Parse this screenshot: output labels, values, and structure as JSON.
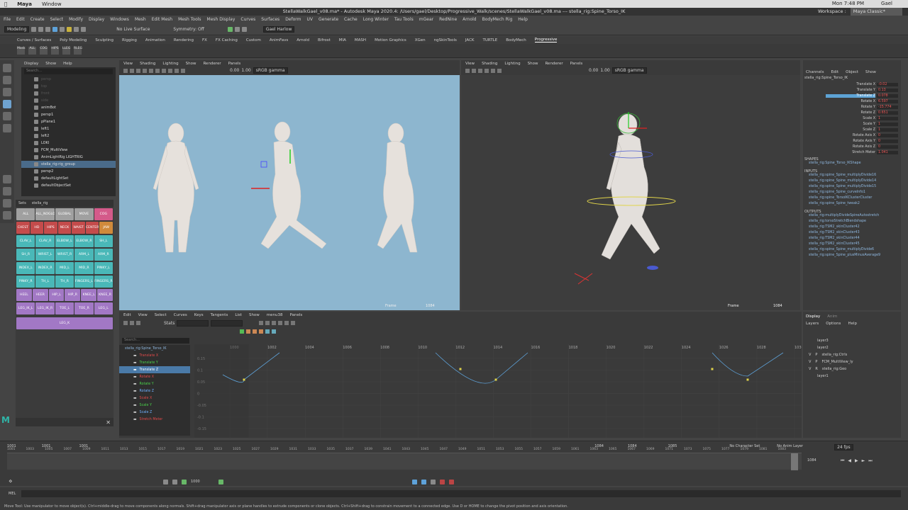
{
  "mac": {
    "app": "Maya",
    "menu": [
      "Window"
    ],
    "time": "Mon 7:48 PM",
    "user": "Gael"
  },
  "title": "StellaWalkGael_v08.ma* - Autodesk Maya 2020.4: /Users/gael/Desktop/Progressive_Walk/scenes/StellaWalkGael_v08.ma  ---  stella_rig:Spine_Torso_IK",
  "workspace": {
    "label": "Workspace :",
    "value": "Maya Classic*"
  },
  "menus": [
    "File",
    "Edit",
    "Create",
    "Select",
    "Modify",
    "Display",
    "Windows",
    "Mesh",
    "Edit Mesh",
    "Mesh Tools",
    "Mesh Display",
    "Curves",
    "Surfaces",
    "Deform",
    "UV",
    "Generate",
    "Cache",
    "Long Winter",
    "Tau Tools",
    "mGear",
    "RedNine",
    "Arnold",
    "BodyMech Rig",
    "Help"
  ],
  "status": {
    "mode": "Modeling",
    "live": "No Live Surface",
    "symmetry": "Symmetry: Off",
    "user": "Gael Harlow"
  },
  "shelf_tabs": [
    "Curves / Surfaces",
    "Poly Modeling",
    "Sculpting",
    "Rigging",
    "Animation",
    "Rendering",
    "FX",
    "FX Caching",
    "Custom",
    "AnimFavs",
    "Arnold",
    "Bifrost",
    "MIA",
    "MASH",
    "Motion Graphics",
    "XGen",
    "ngSkinTools",
    "JACK",
    "TURTLE",
    "BodyMech",
    "Progressive"
  ],
  "shelf_active": "Progressive",
  "shelf_buttons": [
    "Mask",
    "ALL",
    "COG",
    "HIPS",
    "LLEG",
    "RLEG"
  ],
  "outliner": {
    "menu": [
      "Display",
      "Show",
      "Help"
    ],
    "search": "Search...",
    "items": [
      {
        "label": "persp",
        "dim": true
      },
      {
        "label": "top",
        "dim": true
      },
      {
        "label": "front",
        "dim": true
      },
      {
        "label": "side",
        "dim": true
      },
      {
        "label": "animBot"
      },
      {
        "label": "persp1"
      },
      {
        "label": "pPlane1"
      },
      {
        "label": "left1"
      },
      {
        "label": "left2"
      },
      {
        "label": "LOKI"
      },
      {
        "label": "FCM_MultiView"
      },
      {
        "label": "AnimLightRig LIGHTRIG"
      },
      {
        "label": "stella_rig:rig_group",
        "sel": true
      },
      {
        "label": "persp2"
      },
      {
        "label": "defaultLightSet"
      },
      {
        "label": "defaultObjectSet"
      }
    ]
  },
  "picker": {
    "tabs": [
      "Sets",
      "stella_rig"
    ],
    "rows": [
      [
        [
          "ALL",
          "c-gray"
        ],
        [
          "ALL_NOGLOBAL",
          "c-gray"
        ],
        [
          "GLOBAL",
          "c-gray"
        ],
        [
          "MOVE",
          "c-gray"
        ],
        [
          "COG",
          "c-pk"
        ]
      ],
      [
        [
          "CHEST",
          "c-red"
        ],
        [
          "HD",
          "c-red"
        ],
        [
          "HIPS",
          "c-red"
        ],
        [
          "NECK",
          "c-red"
        ],
        [
          "WAIST",
          "c-red"
        ],
        [
          "CENTER",
          "c-red"
        ],
        [
          "JAW",
          "c-or"
        ]
      ],
      [
        [
          "CLAV_L",
          "c-cy"
        ],
        [
          "CLAV_R",
          "c-cy"
        ],
        [
          "ELBOW_L",
          "c-cy"
        ],
        [
          "ELBOW_R",
          "c-cy"
        ],
        [
          "SH_L",
          "c-cy"
        ]
      ],
      [
        [
          "SH_R",
          "c-cy"
        ],
        [
          "WRIST_L",
          "c-cy"
        ],
        [
          "WRIST_R",
          "c-cy"
        ],
        [
          "ARM_L",
          "c-cy"
        ],
        [
          "ARM_R",
          "c-cy"
        ]
      ],
      [
        [
          "INDEX_L",
          "c-cy"
        ],
        [
          "INDEX_R",
          "c-cy"
        ],
        [
          "MID_L",
          "c-cy"
        ],
        [
          "MID_R",
          "c-cy"
        ],
        [
          "PINKY_L",
          "c-cy"
        ]
      ],
      [
        [
          "PINKY_R",
          "c-cy"
        ],
        [
          "TH_L",
          "c-cy"
        ],
        [
          "TH_R",
          "c-cy"
        ],
        [
          "FINGERS_L",
          "c-cy"
        ],
        [
          "FINGERS_R",
          "c-cy"
        ]
      ],
      [
        [
          "HEEL",
          "c-pu"
        ],
        [
          "HEER",
          "c-pu"
        ],
        [
          "HIP_L",
          "c-pu"
        ],
        [
          "HIP_R",
          "c-pu"
        ],
        [
          "KNEE_L",
          "c-pu"
        ],
        [
          "KNEE_R",
          "c-pu"
        ]
      ],
      [
        [
          "LEG_IK_L",
          "c-pu"
        ],
        [
          "LEG_IK_R",
          "c-pu"
        ],
        [
          "TOE_L",
          "c-pu"
        ],
        [
          "TOE_R",
          "c-pu"
        ],
        [
          "LEG_L",
          "c-pu"
        ]
      ],
      [
        [
          "LEG_K",
          "c-pu"
        ]
      ]
    ]
  },
  "viewport_menu": [
    "View",
    "Shading",
    "Lighting",
    "Show",
    "Renderer",
    "Panels"
  ],
  "viewport_vals": {
    "a": "0.00",
    "b": "1.00",
    "gamma": "sRGB gamma"
  },
  "frame_label": "Frame",
  "frame_value": "1084",
  "graph": {
    "menu": [
      "Edit",
      "View",
      "Select",
      "Curves",
      "Keys",
      "Tangents",
      "List",
      "Show",
      "menu38",
      "Panels"
    ],
    "stats": "Stats",
    "search": "Search...",
    "outline_root": "stella_rig:Spine_Torso_IK",
    "channels": [
      {
        "l": "Translate X",
        "c": "#e04a4a"
      },
      {
        "l": "Translate Y",
        "c": "#4ad04a"
      },
      {
        "l": "Translate Z",
        "c": "#6fb0ff",
        "sel": true
      },
      {
        "l": "Rotate X",
        "c": "#e04a4a"
      },
      {
        "l": "Rotate Y",
        "c": "#4ad04a"
      },
      {
        "l": "Rotate Z",
        "c": "#6fb0ff"
      },
      {
        "l": "Scale X",
        "c": "#e04a4a"
      },
      {
        "l": "Scale Y",
        "c": "#4ad04a"
      },
      {
        "l": "Scale Z",
        "c": "#6fb0ff"
      },
      {
        "l": "Stretch Meter",
        "c": "#e04a4a"
      }
    ],
    "xticks": [
      "1000",
      "1002",
      "1004",
      "1006",
      "1008",
      "1010",
      "1012",
      "1014",
      "1016",
      "1018",
      "1020",
      "1022",
      "1024",
      "1026",
      "1028",
      "1030"
    ],
    "yticks": [
      "0.15",
      "0.1",
      "0.05",
      "0",
      "-0.05",
      "-0.1",
      "-0.15"
    ]
  },
  "channelbox": {
    "menu": [
      "Channels",
      "Edit",
      "Object",
      "Show"
    ],
    "object": "stella_rig:Spine_Torso_IK",
    "attrs": [
      [
        "Translate X",
        "-0.02"
      ],
      [
        "Translate Y",
        "0.13"
      ],
      [
        "Translate Z",
        "0.078"
      ],
      [
        "Rotate X",
        "6.597"
      ],
      [
        "Rotate Y",
        "-15.774"
      ],
      [
        "Rotate Z",
        "0.651"
      ],
      [
        "Scale X",
        "1"
      ],
      [
        "Scale Y",
        "1"
      ],
      [
        "Scale Z",
        "1"
      ],
      [
        "Rotate Axis X",
        "0"
      ],
      [
        "Rotate Axis Y",
        "0"
      ],
      [
        "Rotate Axis Z",
        "0"
      ],
      [
        "Stretch Meter",
        "1.041"
      ]
    ],
    "selected": "Translate Z",
    "shapes_label": "SHAPES",
    "shapes": [
      "stella_rig:Spine_Torso_IKShape"
    ],
    "inputs_label": "INPUTS",
    "inputs": [
      "stella_rig:spine_Spine_multiplyDivide16",
      "stella_rig:spine_Spine_multiplyDivide14",
      "stella_rig:spine_Spine_multiplyDivide15",
      "stella_rig:spine_Spine_curveInfo1",
      "stella_rig:spine_TorsoIKClusterCluster",
      "stella_rig:spine_Spine_tweak2"
    ],
    "outputs_label": "OUTPUTS",
    "outputs": [
      "stella_rig:multiplyDivideSpineAutostretch",
      "stella_rig:torsoStretchBlendshape",
      "stella_rig:TSM2_skinCluster42",
      "stella_rig:TSM2_skinCluster43",
      "stella_rig:TSM2_skinCluster44",
      "stella_rig:TSM2_skinCluster45",
      "stella_rig:spine_Spine_multiplyDivide6",
      "stella_rig:spine_Spine_plusMinusAverage9"
    ]
  },
  "layers": {
    "tabs": [
      "Display",
      "Anim"
    ],
    "menu": [
      "Layers",
      "Options",
      "Help"
    ],
    "items": [
      {
        "v": "",
        "p": "",
        "name": "layer3"
      },
      {
        "v": "",
        "p": "",
        "name": "layer2"
      },
      {
        "v": "V",
        "p": "P",
        "name": "stella_rig:Ctrls"
      },
      {
        "v": "V",
        "p": "P",
        "name": "FCM_MultiView_ly"
      },
      {
        "v": "V",
        "p": "R",
        "name": "stella_rig:Geo"
      },
      {
        "v": "",
        "p": "",
        "name": "layer1"
      }
    ]
  },
  "timeslider": {
    "start": "1001",
    "start2": "1001",
    "start3": "1001",
    "end": "1084",
    "end2": "1084",
    "end3": "1085",
    "current": "1084",
    "char_set": "No Character Set",
    "anim_layer": "No Anim Layer",
    "fps": "24 fps",
    "ticks": [
      "1001",
      "1003",
      "1005",
      "1007",
      "1009",
      "1011",
      "1013",
      "1015",
      "1017",
      "1019",
      "1021",
      "1023",
      "1025",
      "1027",
      "1029",
      "1031",
      "1033",
      "1035",
      "1037",
      "1039",
      "1041",
      "1043",
      "1045",
      "1047",
      "1049",
      "1051",
      "1053",
      "1055",
      "1057",
      "1059",
      "1061",
      "1063",
      "1065",
      "1067",
      "1069",
      "1071",
      "1073",
      "1075",
      "1077",
      "1079",
      "1081",
      "1083"
    ]
  },
  "range": {
    "value": "1000"
  },
  "cmd": {
    "label": "MEL"
  },
  "help": "Move Tool: Use manipulator to move object(s). Ctrl+middle-drag to move components along normals. Shift+drag manipulator axis or plane handles to extrude components or clone objects. Ctrl+Shift+drag to constrain movement to a connected edge. Use D or HOME to change the pivot position and axis orientation."
}
